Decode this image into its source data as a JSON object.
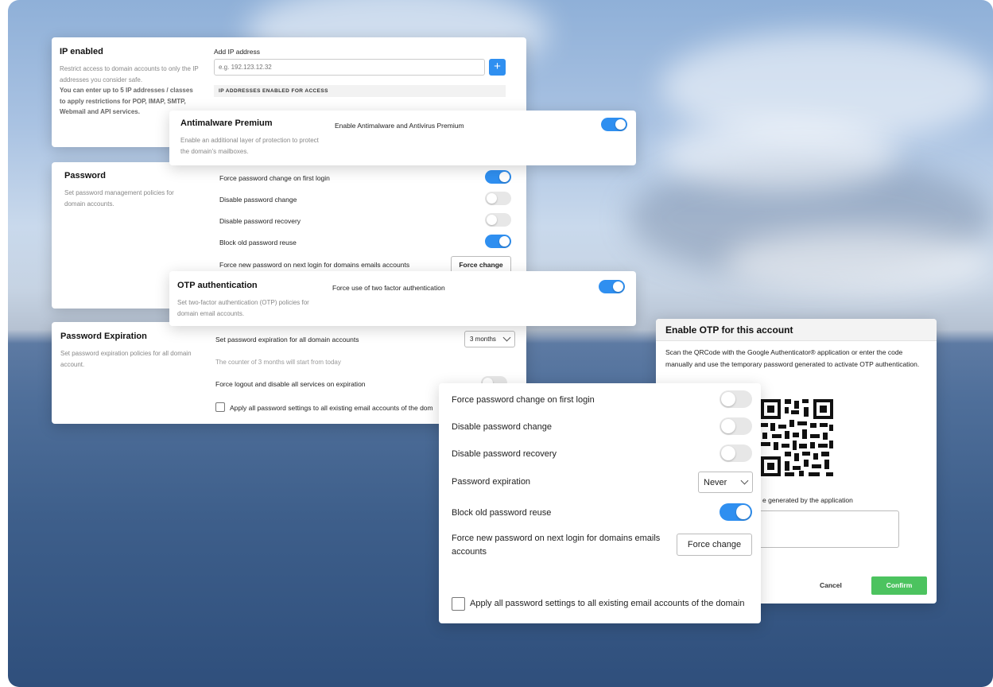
{
  "ip_card": {
    "title": "IP enabled",
    "desc_1": "Restrict access to domain accounts to only the IP addresses you consider safe.",
    "desc_2": "You can enter up to 5 IP addresses / classes to apply restrictions for POP, IMAP, SMTP, Webmail and API services.",
    "add_label": "Add IP address",
    "input_placeholder": "e.g. 192.123.12.32",
    "add_button": "+",
    "list_header": "IP ADDRESSES ENABLED FOR ACCESS"
  },
  "antimalware": {
    "title": "Antimalware Premium",
    "desc": "Enable an additional layer of protection to protect the domain's mailboxes.",
    "toggle_label": "Enable Antimalware and Antivirus Premium",
    "enabled": true
  },
  "password_card": {
    "title": "Password",
    "desc": "Set password management policies for domain accounts.",
    "rows": [
      {
        "label": "Force password change on first login",
        "on": true
      },
      {
        "label": "Disable password change",
        "on": false
      },
      {
        "label": "Disable password recovery",
        "on": false
      },
      {
        "label": "Block old password reuse",
        "on": true
      }
    ],
    "force_label": "Force new password on next login for domains emails accounts",
    "force_button": "Force change"
  },
  "otp_card": {
    "title": "OTP authentication",
    "desc": "Set two-factor authentication (OTP) policies for domain email accounts.",
    "toggle_label": "Force use of two factor authentication",
    "enabled": true
  },
  "expiration_card": {
    "title": "Password Expiration",
    "desc": "Set password expiration policies for all domain account.",
    "set_label": "Set password expiration for all domain accounts",
    "select_value": "3 months",
    "counter_text": "The counter of 3 months will start from today",
    "logout_label": "Force logout and disable all services on expiration",
    "apply_label": "Apply all password settings to all existing email accounts of the dom"
  },
  "otp_modal": {
    "title": "Enable OTP for this account",
    "desc": "Scan the QRCode with the Google Authenticator® application or enter the code manually and use the temporary password generated to activate OTP authentication.",
    "code_label": "e generated by the application",
    "cancel": "Cancel",
    "confirm": "Confirm"
  },
  "front_panel": {
    "rows": [
      {
        "label": "Force password change on first login",
        "on": false
      },
      {
        "label": "Disable password change",
        "on": false
      },
      {
        "label": "Disable password recovery",
        "on": false
      }
    ],
    "expiration_label": "Password expiration",
    "expiration_value": "Never",
    "block_label": "Block old password reuse",
    "block_on": true,
    "force_label": "Force new password on next login for domains emails accounts",
    "force_button": "Force change",
    "apply_label": "Apply all password settings to all existing email accounts of the domain"
  },
  "colors": {
    "accent": "#2f8ff0",
    "confirm": "#4cc35f"
  }
}
